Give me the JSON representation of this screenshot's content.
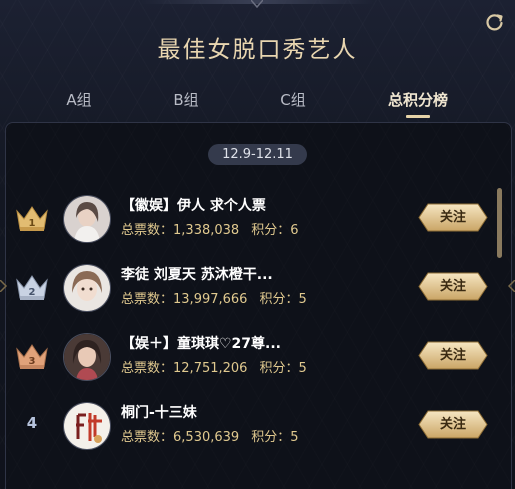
{
  "title": "最佳女脱口秀艺人",
  "tabs": [
    {
      "label": "A组",
      "active": false
    },
    {
      "label": "B组",
      "active": false
    },
    {
      "label": "C组",
      "active": false
    },
    {
      "label": "总积分榜",
      "active": true
    }
  ],
  "date_range": "12.9-12.11",
  "icons": {
    "refresh": "refresh-icon",
    "rank1": "gold-crown-icon",
    "rank2": "silver-crown-icon",
    "rank3": "bronze-crown-icon"
  },
  "colors": {
    "accent_gold": "#e6d3a8",
    "stats_text": "#e0c98f",
    "background": "#0e1119"
  },
  "entries": [
    {
      "rank": "1",
      "name": "【徽娱】伊人 求个人票",
      "votes_label": "总票数：",
      "votes": "1,338,038",
      "score_label": "积分：",
      "score": "6",
      "follow_label": "关注"
    },
    {
      "rank": "2",
      "name": "李徒 刘夏天 苏沐橙干...",
      "votes_label": "总票数：",
      "votes": "13,997,666",
      "score_label": "积分：",
      "score": "5",
      "follow_label": "关注"
    },
    {
      "rank": "3",
      "name": "【娱＋】童琪琪♡27尊...",
      "votes_label": "总票数：",
      "votes": "12,751,206",
      "score_label": "积分：",
      "score": "5",
      "follow_label": "关注"
    },
    {
      "rank": "4",
      "name": "桐门-十三妹",
      "votes_label": "总票数：",
      "votes": "6,530,639",
      "score_label": "积分：",
      "score": "5",
      "follow_label": "关注"
    }
  ]
}
